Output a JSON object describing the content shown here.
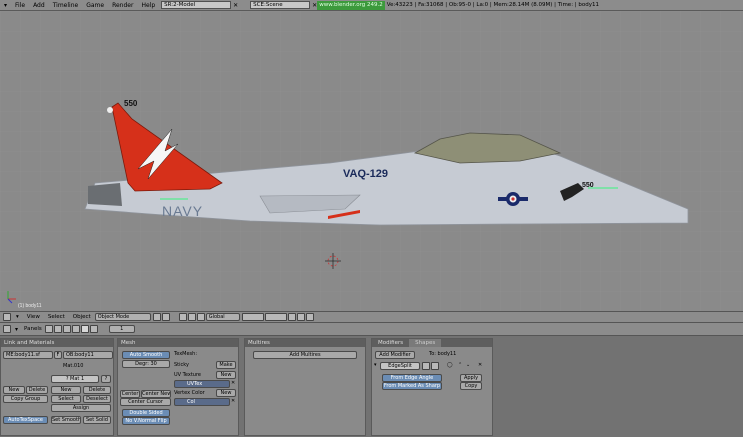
{
  "topbar": {
    "menus": [
      "File",
      "Add",
      "Timeline",
      "Game",
      "Render",
      "Help"
    ],
    "screen": "SR:2-Model",
    "scene": "SCE:Scene",
    "link": "www.blender.org 249.2",
    "stats": "Ve:43223 | Fa:31068 | Ob:95-0 | La:0 | Mem:28.14M (8.09M) | Time: | body11"
  },
  "viewport": {
    "object_label": "(1) body11",
    "tail_number": "550",
    "squadron": "VAQ-129",
    "fuselage_text": "NAVY",
    "nose_number": "550",
    "colors": {
      "fuselage": "#c8cdd6",
      "tail": "#d42a14",
      "canopy": "#8c8c72"
    }
  },
  "viewbar": {
    "items": [
      "View",
      "Select",
      "Object"
    ],
    "mode": "Object Mode",
    "orient": "Global"
  },
  "btnbar": {
    "panels_label": "Panels",
    "page": "1"
  },
  "link_materials": {
    "title": "Link and Materials",
    "me_field": "ME:body11.sf",
    "f_label": "F",
    "ob_field": "OB:body11",
    "mat_name": "Mat.010",
    "mat_count": "? Mat 1",
    "q_btn": "?",
    "new1": "New",
    "delete1": "Delete",
    "new2": "New",
    "delete2": "Delete",
    "copy_group": "Copy Group",
    "select": "Select",
    "deselect": "Deselect",
    "assign": "Assign",
    "autotexspace": "AutoTexSpace",
    "set_smooth": "Set Smooth",
    "set_solid": "Set Solid"
  },
  "mesh": {
    "title": "Mesh",
    "auto_smooth": "Auto Smooth",
    "degr": "Degr: 30",
    "texmesh_label": "TexMesh:",
    "sticky": "Sticky",
    "make": "Make",
    "uv_texture": "UV Texture",
    "new_uv": "New",
    "uvtex": "UVTex",
    "vertex_color": "Vertex Color",
    "new_vc": "New",
    "col": "Col",
    "center": "Center",
    "center_new": "Center New",
    "center_cursor": "Center Cursor",
    "double_sided": "Double Sided",
    "no_vnormal_flip": "No V.Normal Flip"
  },
  "multires": {
    "title": "Multires",
    "add_multires": "Add Multires"
  },
  "modifiers": {
    "tab1": "Modifiers",
    "tab2": "Shapes",
    "add_modifier": "Add Modifier",
    "to": "To: body11",
    "edgesplit": "EdgeSplit",
    "from_edge_angle": "From Edge Angle",
    "from_marked_sharp": "From Marked As Sharp",
    "apply": "Apply",
    "copy": "Copy"
  }
}
